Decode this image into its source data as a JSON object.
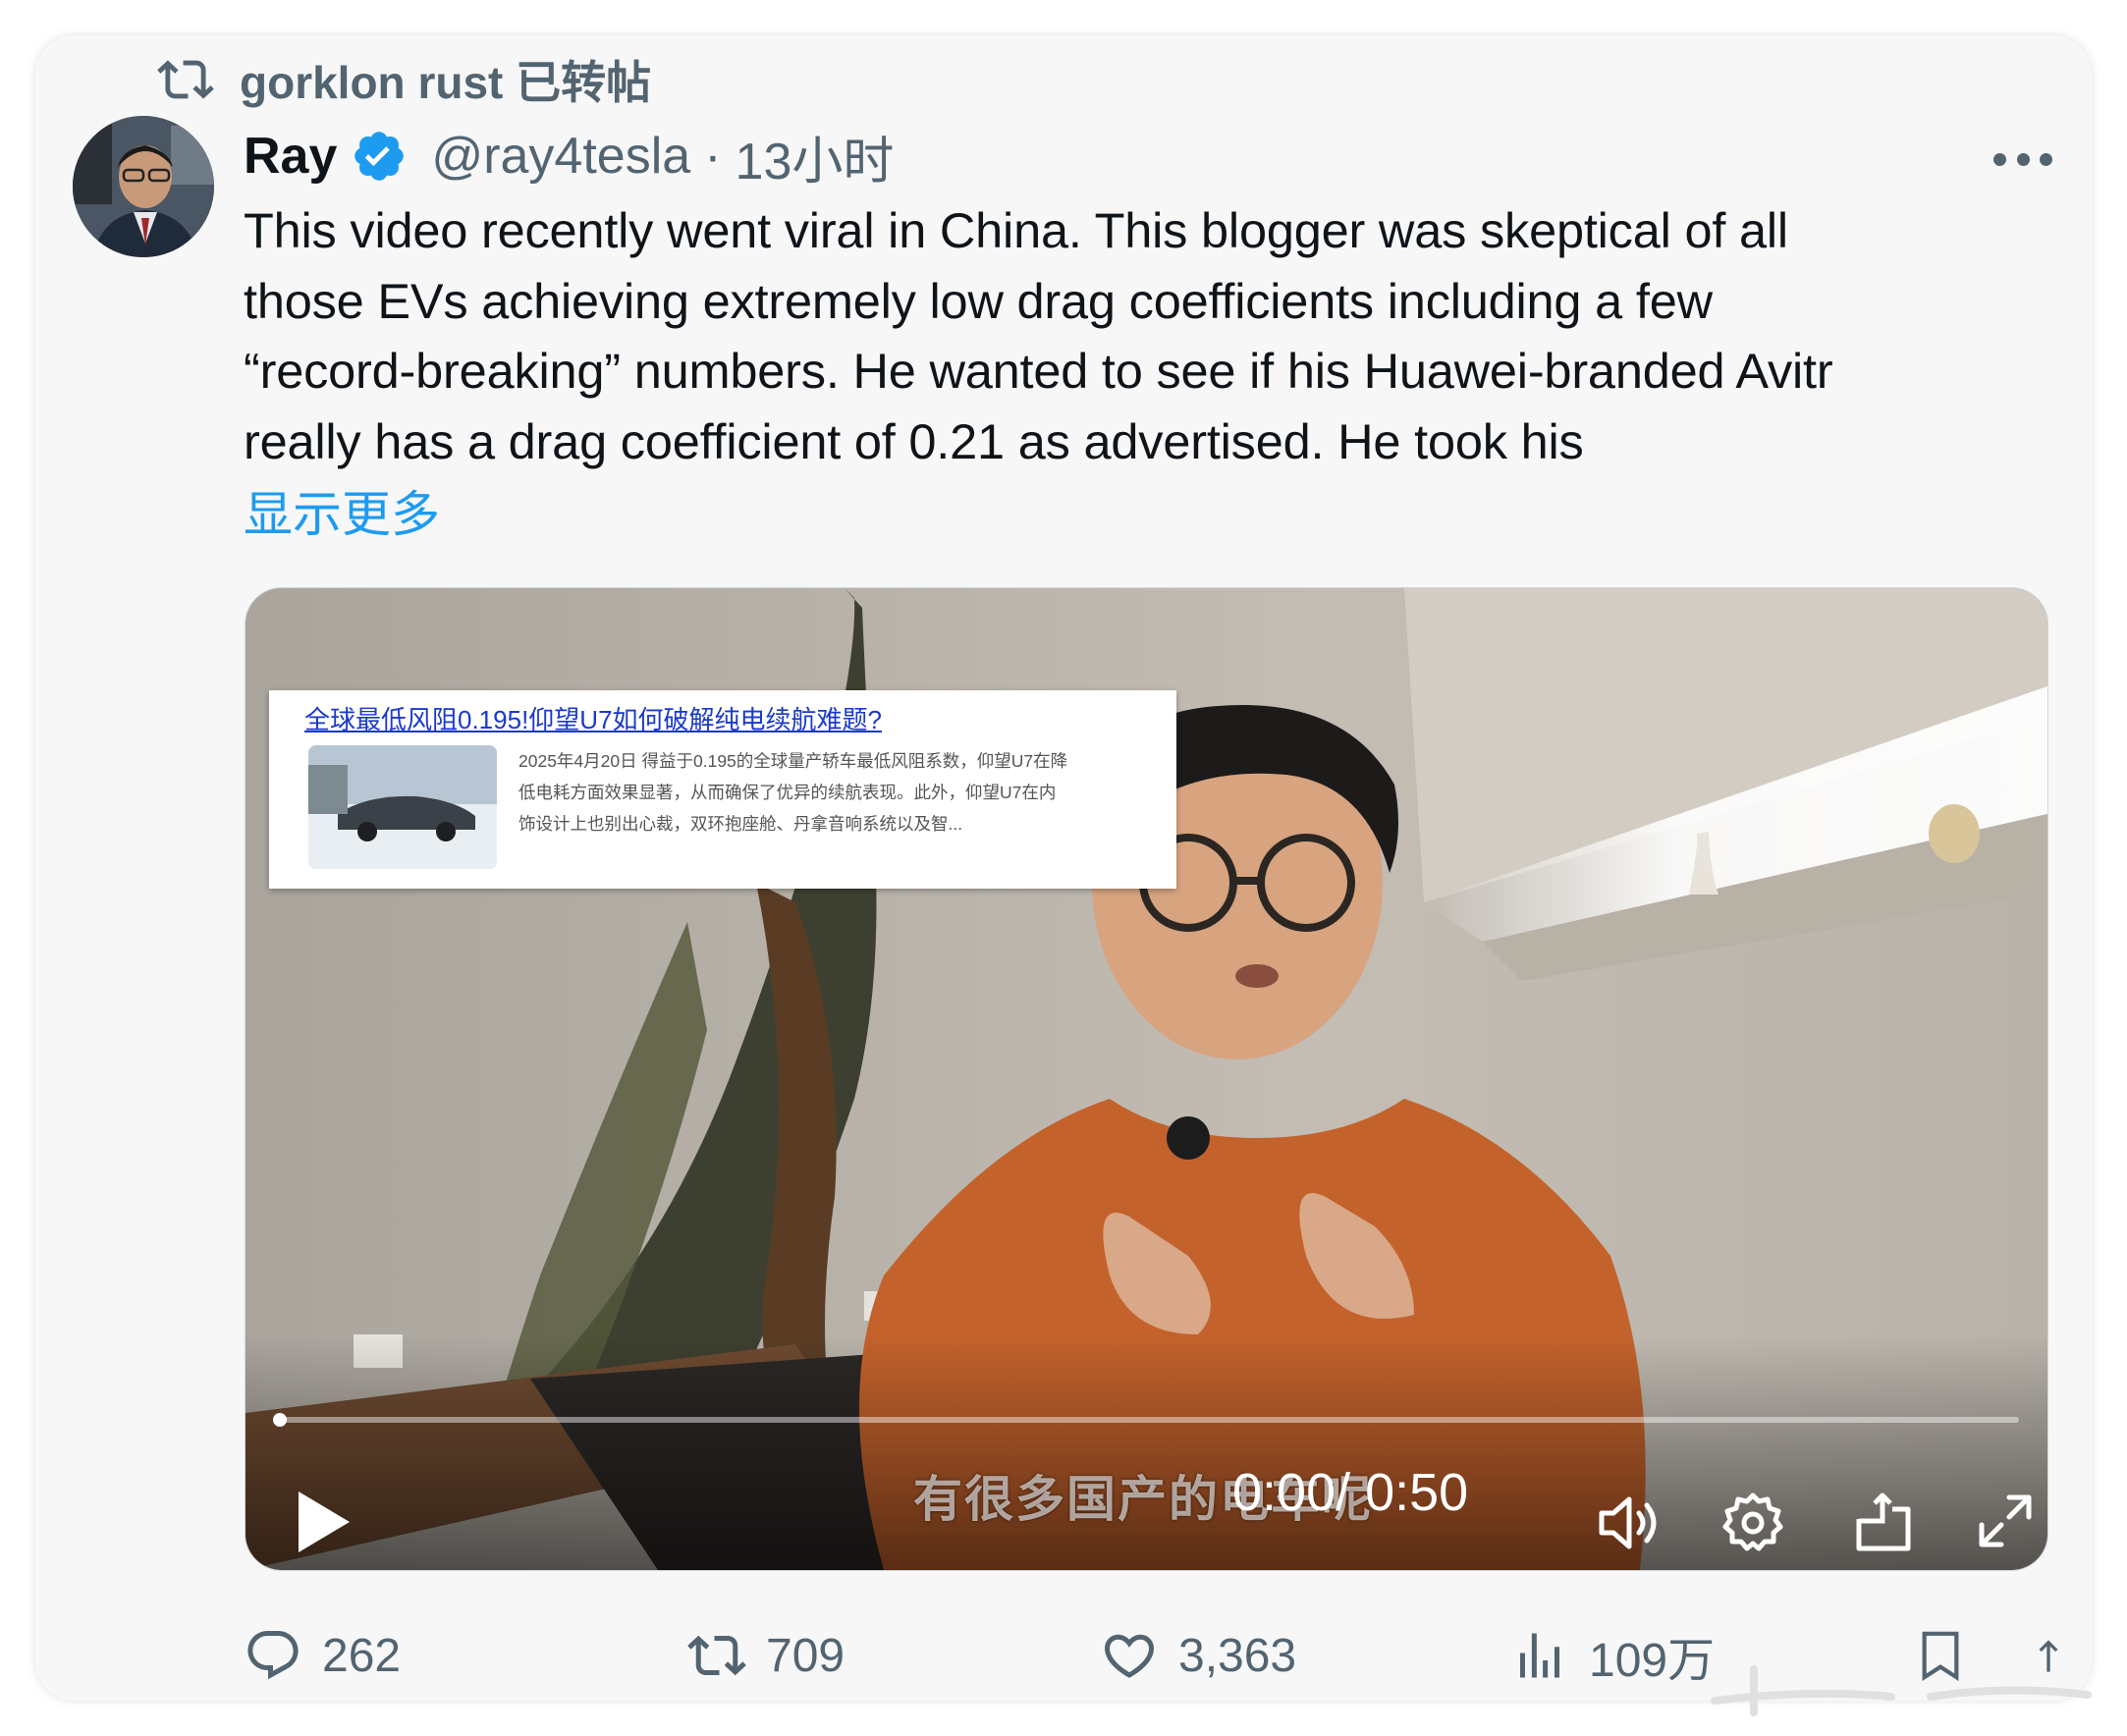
{
  "repost": {
    "text": "gorklon rust 已转帖"
  },
  "author": {
    "name": "Ray",
    "handle": "@ray4tesla",
    "separator": "·",
    "time": "13小时"
  },
  "tweet": {
    "lines": [
      "This video recently went viral in China. This blogger was skeptical of all",
      "those EVs achieving extremely low drag coefficients including a few",
      "“record-breaking” numbers. He wanted to see if his Huawei-branded Avitr",
      "really has a drag coefficient of 0.21 as advertised. He took his"
    ],
    "show_more": "显示更多"
  },
  "video": {
    "overlay_headline": "全球最低风阻0.195!仰望U7如何破解纯电续航难题?",
    "overlay_snippet": [
      "2025年4月20日 得益于0.195的全球量产轿车最低风阻系数，仰望U7在降",
      "低电耗方面效果显著，从而确保了优异的续航表现。此外，仰望U7在内",
      "饰设计上也别出心裁，双环抱座舱、丹拿音响系统以及智..."
    ],
    "subtitle": "有很多国产的电车呢",
    "current_time": "0:00",
    "duration": "/ 0:50",
    "progress": 0.0
  },
  "actions": {
    "replies": "262",
    "reposts": "709",
    "likes": "3,363",
    "views": "109万"
  },
  "colors": {
    "accent": "#1d9bf0",
    "muted": "#536471",
    "text": "#0f1419",
    "card_bg": "#f7f7f7"
  },
  "icons": [
    "repost-icon",
    "verified-badge-icon",
    "more-icon",
    "play-icon",
    "volume-icon",
    "settings-icon",
    "pip-icon",
    "fullscreen-icon",
    "reply-icon",
    "like-icon",
    "views-icon",
    "bookmark-icon",
    "share-icon"
  ]
}
